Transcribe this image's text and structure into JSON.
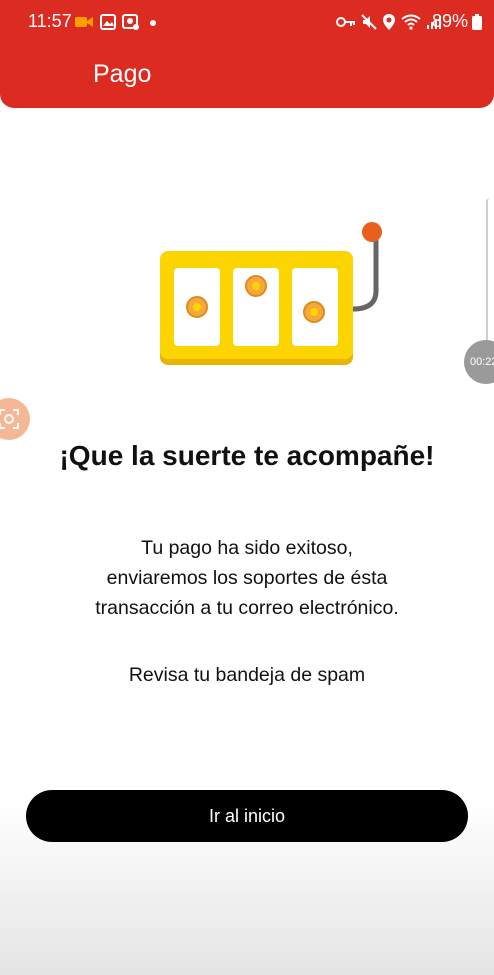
{
  "status_bar": {
    "time": "11:57",
    "battery": "89%",
    "left_icons": [
      "video-camera-icon",
      "gallery-icon",
      "notification-icon",
      "dot-icon"
    ],
    "right_icons": [
      "key-icon",
      "mute-icon",
      "location-icon",
      "wifi-icon",
      "signal-icon"
    ]
  },
  "header": {
    "title": "Pago",
    "background": "#dc2b20"
  },
  "illustration": {
    "icon": "slot-machine-icon",
    "colors": {
      "frame": "#fcd400",
      "frame_shadow": "#e8b400",
      "coin": "#f4a93a",
      "lever_knob": "#e8601c",
      "lever": "#666666"
    }
  },
  "content": {
    "headline": "¡Que la suerte te acompañe!",
    "message_lines": [
      "Tu pago ha sido exitoso,",
      "enviaremos los soportes de ésta",
      "transacción a tu correo electrónico."
    ],
    "spam_note": "Revisa tu bandeja de spam"
  },
  "actions": {
    "home_button": "Ir al inicio"
  },
  "overlay": {
    "timer": "00:22",
    "screen-record-icon": "screen-record-icon"
  }
}
